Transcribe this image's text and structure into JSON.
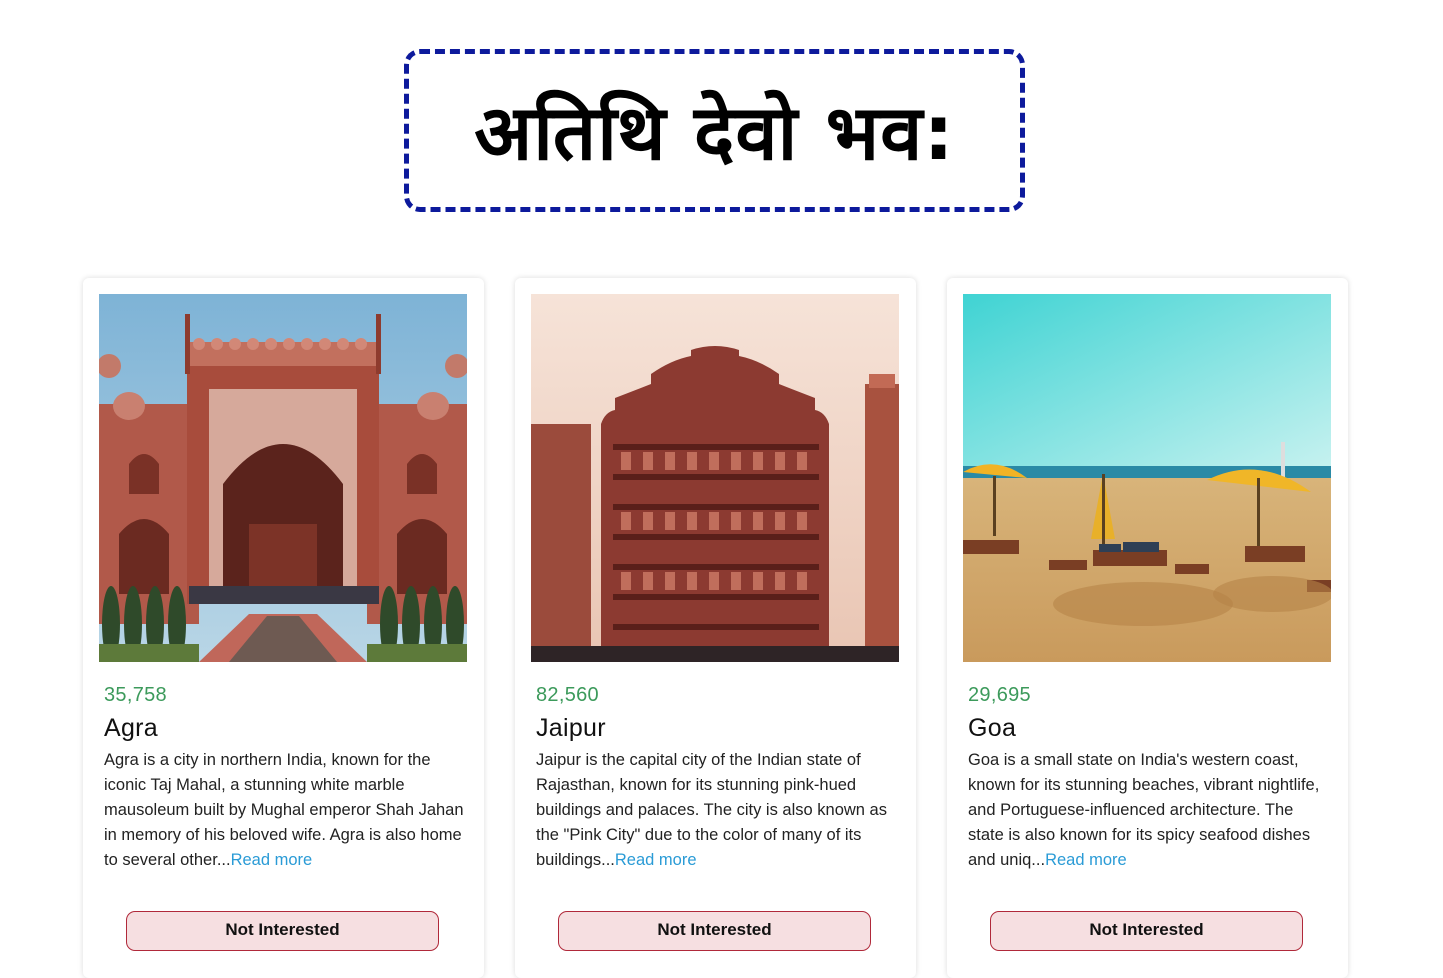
{
  "header": {
    "title": "अतिथि देवो भव:"
  },
  "tours": [
    {
      "price": "35,758",
      "name": "Agra",
      "description": "Agra is a city in northern India, known for the iconic Taj Mahal, a stunning white marble mausoleum built by Mughal emperor Shah Jahan in memory of his beloved wife. Agra is also home to several other...",
      "read_more": "Read more",
      "button": "Not Interested"
    },
    {
      "price": "82,560",
      "name": "Jaipur",
      "description": "Jaipur is the capital city of the Indian state of Rajasthan, known for its stunning pink-hued buildings and palaces. The city is also known as the \"Pink City\" due to the color of many of its buildings...",
      "read_more": "Read more",
      "button": "Not Interested"
    },
    {
      "price": "29,695",
      "name": "Goa",
      "description": "Goa is a small state on India's western coast, known for its stunning beaches, vibrant nightlife, and Portuguese-influenced architecture. The state is also known for its spicy seafood dishes and uniq...",
      "read_more": "Read more",
      "button": "Not Interested"
    }
  ],
  "colors": {
    "title_border": "#0d1a9c",
    "price": "#3c9a5b",
    "link": "#2a9bd6",
    "button_bg": "#f6dfe1",
    "button_border": "#b0293a"
  }
}
